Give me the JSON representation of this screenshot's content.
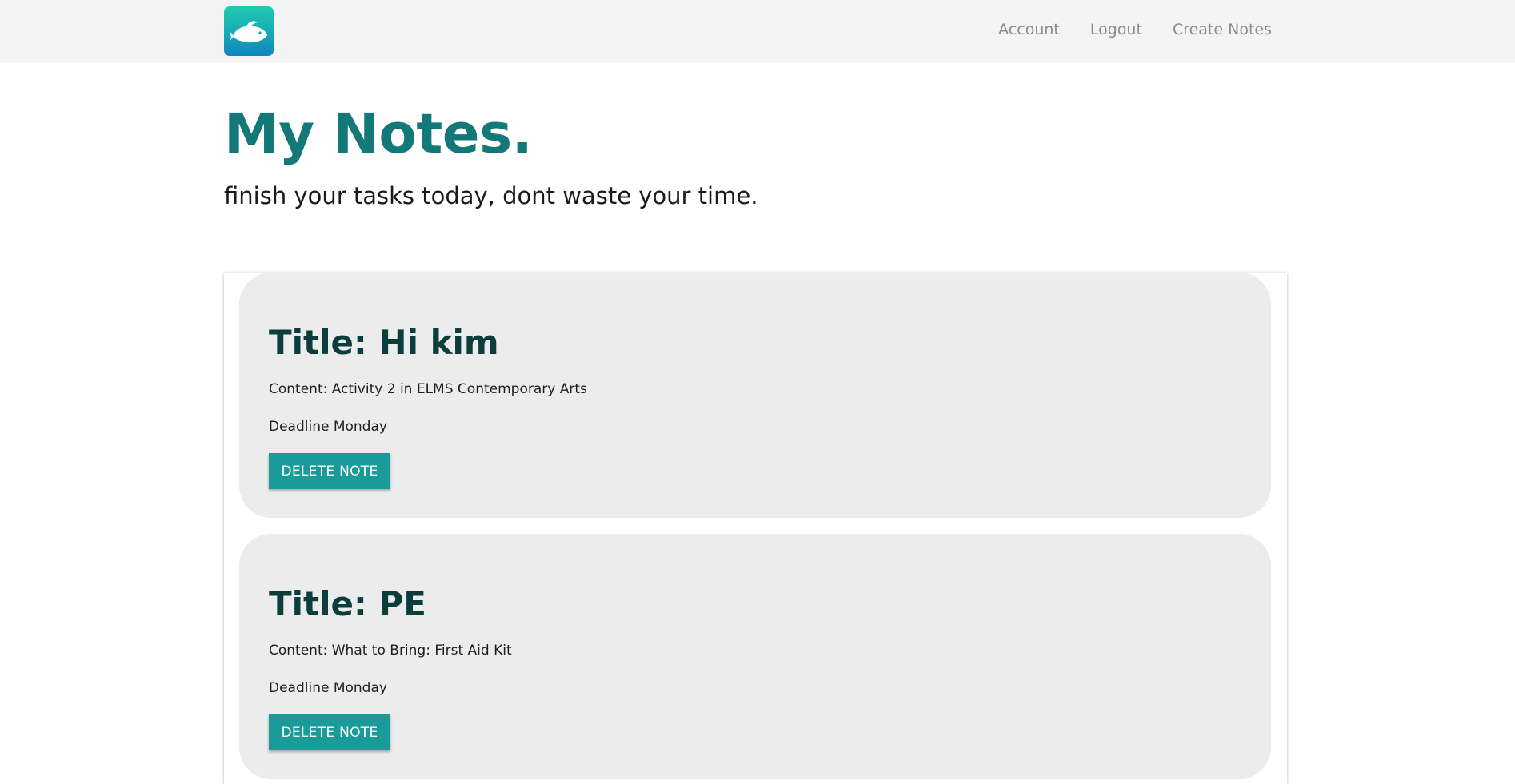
{
  "nav": {
    "logo_icon": "fish-icon",
    "links": [
      {
        "label": "Account"
      },
      {
        "label": "Logout"
      },
      {
        "label": "Create Notes"
      }
    ]
  },
  "header": {
    "title": "My Notes.",
    "subtitle": "finish your tasks today, dont waste your time."
  },
  "notes": [
    {
      "title": "Title: Hi kim",
      "content": "Content: Activity 2 in ELMS Contemporary Arts",
      "deadline": "Deadline Monday",
      "delete_label": "DELETE NOTE"
    },
    {
      "title": "Title: PE",
      "content": "Content: What to Bring: First Aid Kit",
      "deadline": "Deadline Monday",
      "delete_label": "DELETE NOTE"
    }
  ],
  "colors": {
    "navbar_bg": "#f4f4f4",
    "title": "#127878",
    "note_title": "#0c3d3d",
    "button": "#1a9a98",
    "card_bg": "#ececec"
  }
}
